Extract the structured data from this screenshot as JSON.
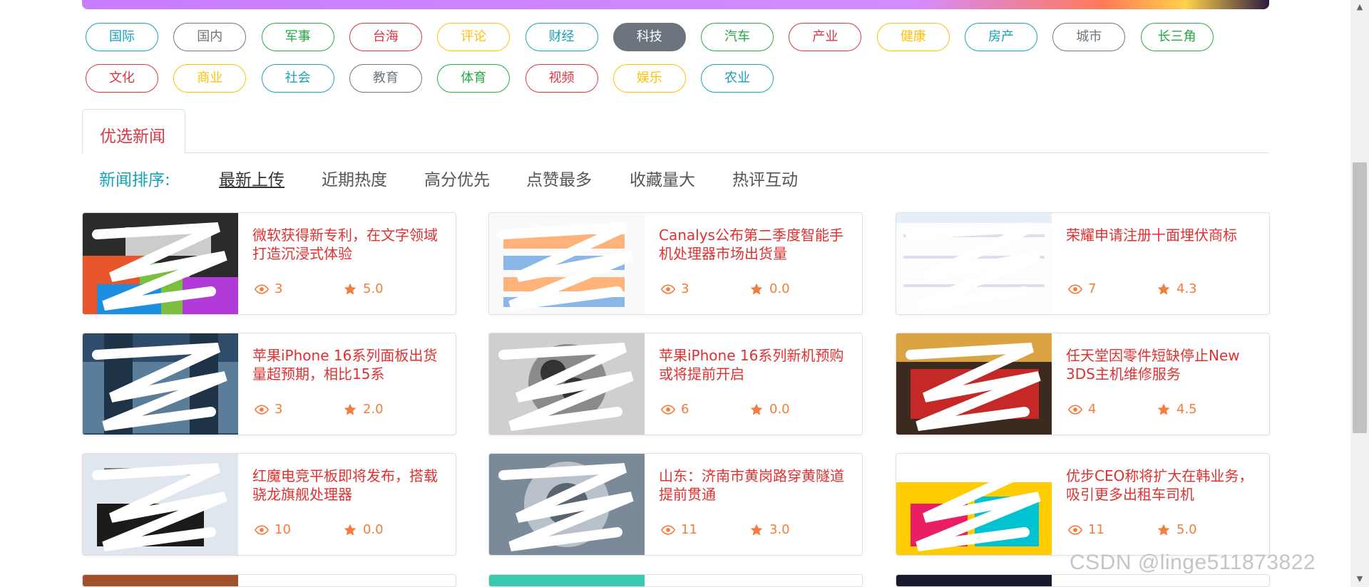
{
  "categories": [
    {
      "label": "国际",
      "color": "#17a2b8"
    },
    {
      "label": "国内",
      "color": "#6c757d"
    },
    {
      "label": "军事",
      "color": "#28a745"
    },
    {
      "label": "台海",
      "color": "#dc3545"
    },
    {
      "label": "评论",
      "color": "#ffc107"
    },
    {
      "label": "财经",
      "color": "#17a2b8"
    },
    {
      "label": "科技",
      "color": "#6c757d",
      "active": true
    },
    {
      "label": "汽车",
      "color": "#28a745"
    },
    {
      "label": "产业",
      "color": "#dc3545"
    },
    {
      "label": "健康",
      "color": "#ffc107"
    },
    {
      "label": "房产",
      "color": "#17a2b8"
    },
    {
      "label": "城市",
      "color": "#6c757d"
    },
    {
      "label": "长三角",
      "color": "#28a745"
    },
    {
      "label": "文化",
      "color": "#dc3545"
    },
    {
      "label": "商业",
      "color": "#ffc107"
    },
    {
      "label": "社会",
      "color": "#17a2b8"
    },
    {
      "label": "教育",
      "color": "#6c757d"
    },
    {
      "label": "体育",
      "color": "#28a745"
    },
    {
      "label": "视频",
      "color": "#dc3545"
    },
    {
      "label": "娱乐",
      "color": "#ffc107"
    },
    {
      "label": "农业",
      "color": "#17a2b8"
    }
  ],
  "tab": {
    "label": "优选新闻"
  },
  "sort": {
    "title": "新闻排序:",
    "items": [
      "最新上传",
      "近期热度",
      "高分优先",
      "点赞最多",
      "收藏量大",
      "热评互动"
    ],
    "active_index": 0
  },
  "cards": [
    {
      "title": "微软获得新专利，在文字领域打造沉浸式体验",
      "views": "3",
      "rating": "5.0",
      "thumb": "microsoft-keyboard"
    },
    {
      "title": "Canalys公布第二季度智能手机处理器市场出货量",
      "views": "3",
      "rating": "0.0",
      "thumb": "chart-table"
    },
    {
      "title": "荣耀申请注册十面埋伏商标",
      "views": "7",
      "rating": "4.3",
      "thumb": "trademark-page"
    },
    {
      "title": "苹果iPhone 16系列面板出货量超预期，相比15系",
      "views": "3",
      "rating": "2.0",
      "thumb": "apple-store"
    },
    {
      "title": "苹果iPhone 16系列新机预购或将提前开启",
      "views": "6",
      "rating": "0.0",
      "thumb": "iphone-back"
    },
    {
      "title": "任天堂因零件短缺停止New 3DS主机维修服务",
      "views": "4",
      "rating": "4.5",
      "thumb": "nintendo-switch"
    },
    {
      "title": "红魔电竞平板即将发布，搭载骁龙旗舰处理器",
      "views": "10",
      "rating": "0.0",
      "thumb": "tablet-promo"
    },
    {
      "title": "山东：济南市黄岗路穿黄隧道提前贯通",
      "views": "11",
      "rating": "3.0",
      "thumb": "tunnel-machine"
    },
    {
      "title": "优步CEO称将扩大在韩业务，吸引更多出租车司机",
      "views": "11",
      "rating": "5.0",
      "thumb": "uber-article"
    }
  ],
  "watermark": "CSDN @linge511873822",
  "colors": {
    "accent_red": "#e03131",
    "stat_orange": "#f47c3c",
    "teal": "#17a2b8"
  }
}
